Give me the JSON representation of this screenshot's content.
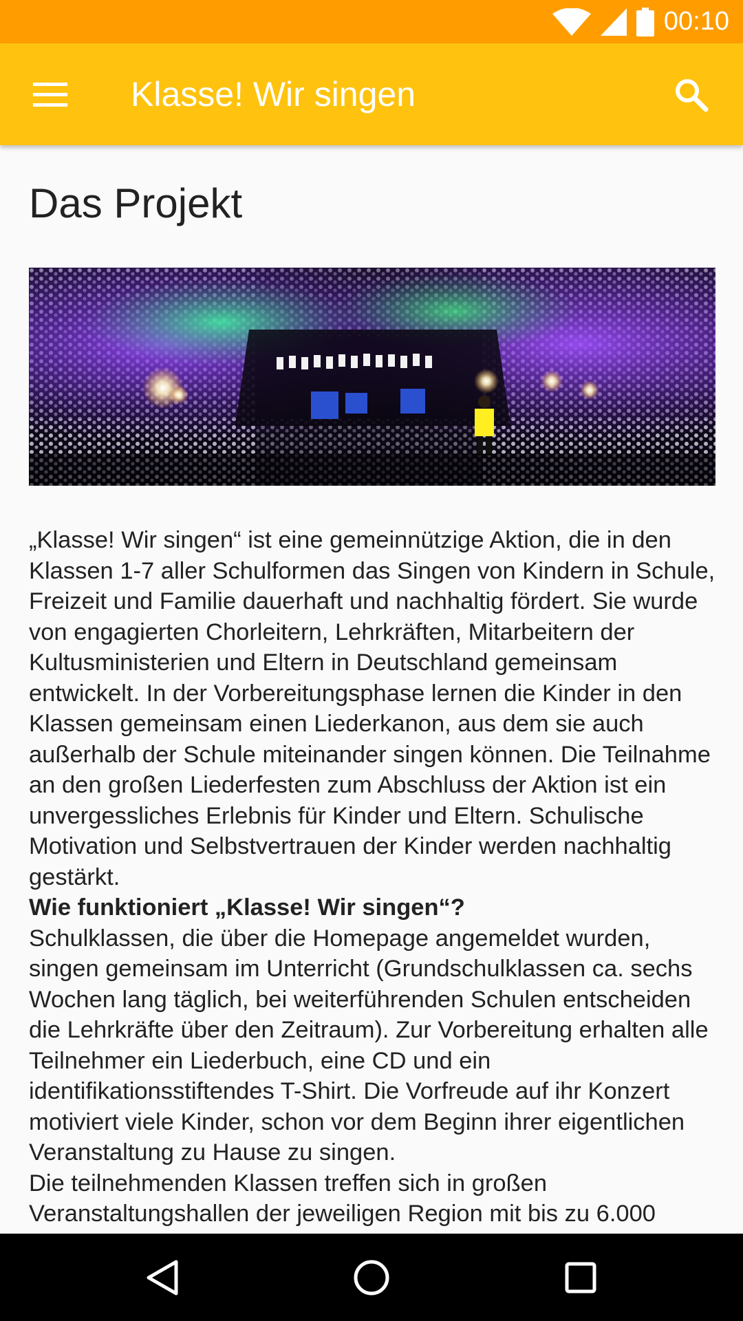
{
  "status_bar": {
    "time": "00:10",
    "icons": [
      "wifi-icon",
      "signal-icon",
      "battery-icon"
    ]
  },
  "app_bar": {
    "title": "Klasse! Wir singen",
    "menu_icon": "menu-icon",
    "search_icon": "search-icon",
    "background": "#ffc20e"
  },
  "page": {
    "title": "Das Projekt",
    "hero_image": "choir-concert-photo"
  },
  "article": {
    "intro": "„Klasse! Wir singen“ ist eine gemeinnützige Aktion, die in den Klassen 1-7 aller Schulformen das Singen von Kindern in Schule, Freizeit und Familie dauerhaft und nachhaltig fördert. Sie wurde von engagierten Chorleitern, Lehrkräften, Mitarbeitern der Kultusministerien und Eltern in Deutschland gemeinsam entwickelt. In der Vorbereitungsphase lernen die Kinder in den Klassen gemeinsam einen Liederkanon, aus dem sie auch außerhalb der Schule miteinander singen können. Die Teilnahme an den großen Liederfesten zum Abschluss der Aktion ist ein unvergessliches Erlebnis für Kinder und Eltern. Schulische Motivation und Selbstvertrauen der Kinder werden nachhaltig gestärkt.",
    "heading": "Wie funktioniert „Klasse! Wir singen“?",
    "paragraph2": "Schulklassen, die über die Homepage angemeldet wurden, singen gemeinsam im Unterricht (Grundschulklassen ca. sechs Wochen lang täglich, bei weiterführenden Schulen entscheiden die Lehrkräfte über den Zeitraum). Zur Vorbereitung erhalten alle Teilnehmer ein Liederbuch, eine CD und ein identifikationsstiftendes T-Shirt. Die Vorfreude auf ihr Konzert motiviert viele Kinder, schon vor dem Beginn ihrer eigentlichen Veranstaltung zu Hause zu singen.",
    "paragraph3": "Die teilnehmenden Klassen treffen sich in großen Veranstaltungshallen der jeweiligen Region mit bis zu 6.000"
  },
  "nav_bar": {
    "icons": [
      "back-icon",
      "home-icon",
      "recents-icon"
    ]
  },
  "colors": {
    "status_bar": "#ff9d00",
    "app_bar": "#ffc20e",
    "text": "#222222",
    "background": "#fafafa"
  }
}
